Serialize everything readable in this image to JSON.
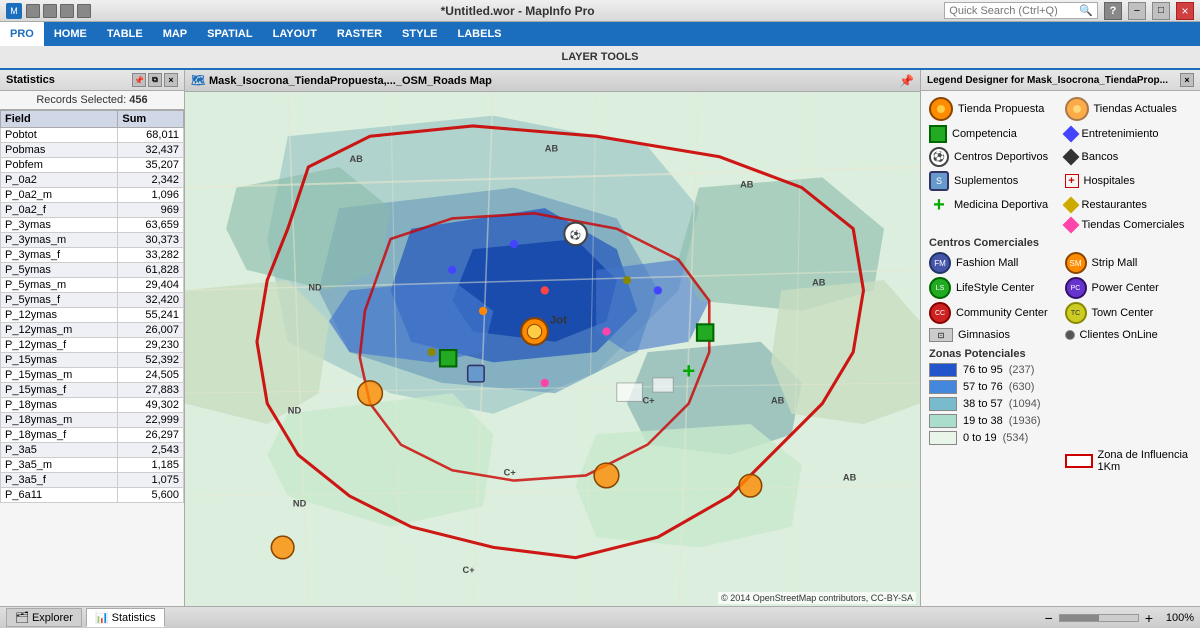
{
  "titlebar": {
    "left_icons": [
      "app1",
      "app2",
      "app3",
      "app4"
    ],
    "title": "*Untitled.wor - MapInfo Pro",
    "search_placeholder": "Quick Search (Ctrl+Q)",
    "help_btn": "?",
    "minimize_btn": "−",
    "maximize_btn": "□",
    "close_btn": "×"
  },
  "menubar": {
    "items": [
      {
        "label": "PRO",
        "active": true
      },
      {
        "label": "HOME"
      },
      {
        "label": "TABLE"
      },
      {
        "label": "MAP"
      },
      {
        "label": "SPATIAL"
      },
      {
        "label": "LAYOUT"
      },
      {
        "label": "RASTER"
      },
      {
        "label": "STYLE"
      },
      {
        "label": "LABELS"
      }
    ]
  },
  "ribbon": {
    "center_label": "LAYER TOOLS"
  },
  "stats_panel": {
    "title": "Statistics",
    "controls": [
      "pin",
      "float",
      "close"
    ],
    "records_selected_label": "Records Selected:",
    "records_selected_value": "456",
    "columns": [
      "Field",
      "Sum"
    ],
    "rows": [
      {
        "field": "Pobtot",
        "sum": "68,011"
      },
      {
        "field": "Pobmas",
        "sum": "32,437"
      },
      {
        "field": "Pobfem",
        "sum": "35,207"
      },
      {
        "field": "P_0a2",
        "sum": "2,342"
      },
      {
        "field": "P_0a2_m",
        "sum": "1,096"
      },
      {
        "field": "P_0a2_f",
        "sum": "969"
      },
      {
        "field": "P_3ymas",
        "sum": "63,659"
      },
      {
        "field": "P_3ymas_m",
        "sum": "30,373"
      },
      {
        "field": "P_3ymas_f",
        "sum": "33,282"
      },
      {
        "field": "P_5ymas",
        "sum": "61,828"
      },
      {
        "field": "P_5ymas_m",
        "sum": "29,404"
      },
      {
        "field": "P_5ymas_f",
        "sum": "32,420"
      },
      {
        "field": "P_12ymas",
        "sum": "55,241"
      },
      {
        "field": "P_12ymas_m",
        "sum": "26,007"
      },
      {
        "field": "P_12ymas_f",
        "sum": "29,230"
      },
      {
        "field": "P_15ymas",
        "sum": "52,392"
      },
      {
        "field": "P_15ymas_m",
        "sum": "24,505"
      },
      {
        "field": "P_15ymas_f",
        "sum": "27,883"
      },
      {
        "field": "P_18ymas",
        "sum": "49,302"
      },
      {
        "field": "P_18ymas_m",
        "sum": "22,999"
      },
      {
        "field": "P_18ymas_f",
        "sum": "26,297"
      },
      {
        "field": "P_3a5",
        "sum": "2,543"
      },
      {
        "field": "P_3a5_m",
        "sum": "1,185"
      },
      {
        "field": "P_3a5_f",
        "sum": "1,075"
      },
      {
        "field": "P_6a11",
        "sum": "5,600"
      }
    ]
  },
  "map": {
    "title": "Mask_Isocrona_TiendaPropuesta,..._OSM_Roads Map",
    "copyright": "© 2014 OpenStreetMap contributors, CC-BY-SA",
    "pin_label": "Jot"
  },
  "legend": {
    "title": "Legend Designer for Mask_Isocrona_TiendaProp...",
    "items_row1": [
      {
        "label": "Tienda Propuesta",
        "icon": "orange-pin"
      },
      {
        "label": "Tiendas Actuales",
        "icon": "orange-pin-outline"
      }
    ],
    "items_row2": [
      {
        "label": "Competencia",
        "icon": "green-square"
      },
      {
        "label": "Entretenimiento",
        "icon": "blue-diamond"
      }
    ],
    "items_row3": [
      {
        "label": "Centros Deportivos",
        "icon": "soccer"
      },
      {
        "label": "Bancos",
        "icon": "dark-diamond"
      }
    ],
    "items_row4": [
      {
        "label": "Suplementos",
        "icon": "supp"
      },
      {
        "label": "Hospitales",
        "icon": "red-cross-small"
      }
    ],
    "items_row5": [
      {
        "label": "Medicina Deportiva",
        "icon": "green-cross"
      },
      {
        "label": "Restaurantes",
        "icon": "yellow-diamond"
      }
    ],
    "items_row6": [
      {
        "label": "",
        "icon": ""
      },
      {
        "label": "Tiendas Comerciales",
        "icon": "pink-diamond"
      }
    ],
    "section_centros": "Centros Comerciales",
    "centros_items": [
      {
        "label": "Fashion Mall",
        "icon": "fashion-mall"
      },
      {
        "label": "Strip Mall",
        "icon": "strip-mall"
      },
      {
        "label": "LifeStyle Center",
        "icon": "lifestyle"
      },
      {
        "label": "Power Center",
        "icon": "power-center"
      },
      {
        "label": "Community Center",
        "icon": "community"
      },
      {
        "label": "Town Center",
        "icon": "town-center"
      }
    ],
    "gimnasios_label": "Gimnasios",
    "clientes_label": "Clientes OnLine",
    "section_zonas": "Zonas Potenciales",
    "zonas": [
      {
        "range": "76 to 95",
        "count": "(237)",
        "color": "#2255cc"
      },
      {
        "range": "57 to 76",
        "count": "(630)",
        "color": "#4488dd"
      },
      {
        "range": "38 to 57",
        "count": "(1094)",
        "color": "#77bbcc"
      },
      {
        "range": "19 to 38",
        "count": "(1936)",
        "color": "#aaddcc"
      },
      {
        "range": "0 to 19",
        "count": "(534)",
        "color": "#e8f5e8"
      }
    ],
    "zona_influencia_label": "Zona de Influencia 1Km"
  },
  "statusbar": {
    "explorer_tab": "Explorer",
    "statistics_tab": "Statistics",
    "zoom_label": "100%",
    "zoom_minus": "−",
    "zoom_plus": "+"
  }
}
